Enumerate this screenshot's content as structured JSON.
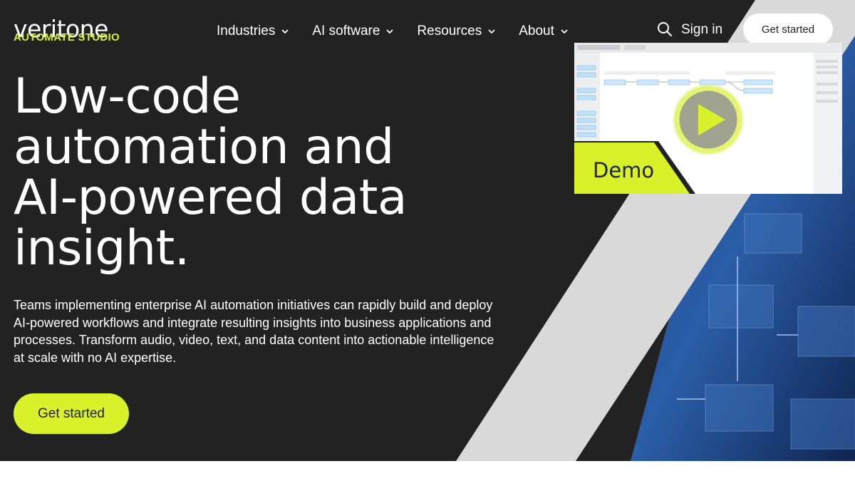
{
  "brand": {
    "name": "veritone",
    "product": "AUTOMATE STUDIO",
    "accent_color": "#d8f12a",
    "dark_bg": "#222222"
  },
  "nav": {
    "items": [
      {
        "label": "Industries",
        "icon": "chevron-down-icon"
      },
      {
        "label": "AI software",
        "icon": "chevron-down-icon"
      },
      {
        "label": "Resources",
        "icon": "chevron-down-icon"
      },
      {
        "label": "About",
        "icon": "chevron-down-icon"
      }
    ],
    "search_icon": "search-icon",
    "sign_in_label": "Sign in",
    "get_started_label": "Get started"
  },
  "hero": {
    "headline_lines": [
      "Low-code",
      "automation and",
      "AI-powered data",
      "insight."
    ],
    "description": "Teams implementing enterprise AI automation initiatives can rapidly build and deploy AI-powered workflows and integrate resulting insights into business applications and processes. Transform audio, video, text, and data content into actionable intelligence at scale with no AI expertise.",
    "cta_label": "Get started"
  },
  "video": {
    "label": "Demo",
    "play_icon": "play-icon"
  }
}
